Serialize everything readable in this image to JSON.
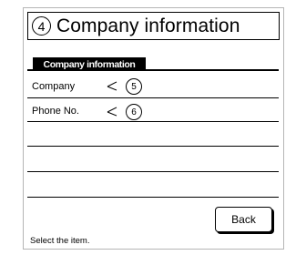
{
  "header": {
    "step_number": "4",
    "title": "Company information"
  },
  "tab": {
    "label": "Company information"
  },
  "rows": [
    {
      "label": "Company",
      "callout": "5"
    },
    {
      "label": "Phone No.",
      "callout": "6"
    }
  ],
  "buttons": {
    "back_label": "Back"
  },
  "status": {
    "message": "Select the item."
  }
}
